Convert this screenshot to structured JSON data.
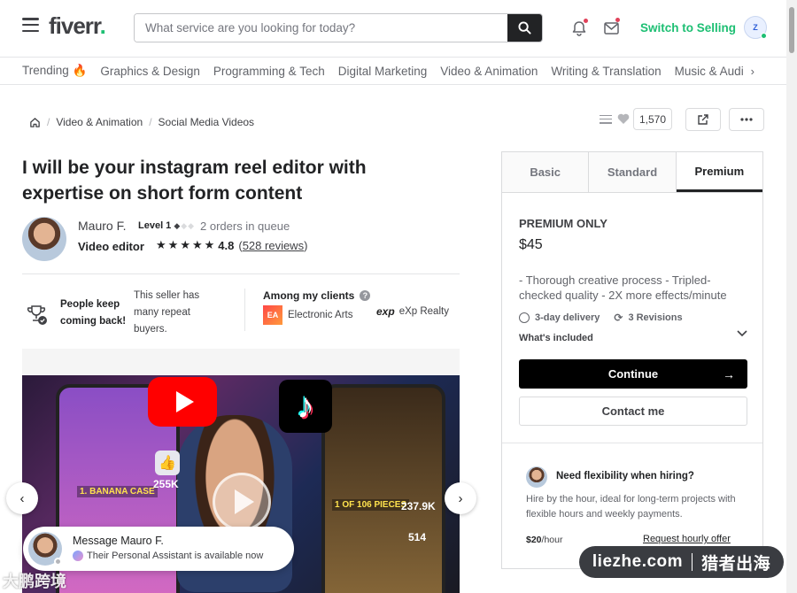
{
  "header": {
    "logo_text": "fiverr",
    "logo_dot": ".",
    "search_placeholder": "What service are you looking for today?",
    "switch_label": "Switch to Selling",
    "avatar_text": "Z"
  },
  "categories": [
    "Trending 🔥",
    "Graphics & Design",
    "Programming & Tech",
    "Digital Marketing",
    "Video & Animation",
    "Writing & Translation",
    "Music & Audi"
  ],
  "categories_more": "›",
  "breadcrumb": {
    "sep1": "/",
    "item1": "Video & Animation",
    "sep2": "/",
    "item2": "Social Media Videos"
  },
  "actions": {
    "likes_count": "1,570"
  },
  "gig": {
    "title": "I will be your instagram reel editor with expertise on short form content"
  },
  "seller": {
    "name": "Mauro F.",
    "level": "Level 1",
    "queue": "2 orders in queue",
    "role": "Video editor",
    "rating": "4.8",
    "reviews_open": "(",
    "reviews": "528 reviews",
    "reviews_close": ")"
  },
  "info": {
    "keep_back": "People keep coming back!",
    "repeat": "This seller has many repeat buyers.",
    "clients_title": "Among my clients",
    "client1_logo": "EA",
    "client1": "Electronic Arts",
    "client2_logo": "exp",
    "client2": "eXp Realty"
  },
  "gallery": {
    "label1": "1. BANANA CASE",
    "count1": "255K",
    "label2": "1 OF 106 PIECES",
    "count2": "237.9K",
    "count3": "514"
  },
  "message": {
    "title": "Message Mauro F.",
    "subtitle": "Their Personal Assistant is available now"
  },
  "package": {
    "tabs": [
      "Basic",
      "Standard",
      "Premium"
    ],
    "active_tab": 2,
    "name": "PREMIUM ONLY",
    "price": "$45",
    "description": "- Thorough creative process - Tripled-checked quality - 2X more effects/minute",
    "delivery": "3-day delivery",
    "revisions": "3 Revisions",
    "included": "What's included",
    "continue_label": "Continue",
    "contact_label": "Contact me"
  },
  "hourly": {
    "title": "Need flexibility when hiring?",
    "description": "Hire by the hour, ideal for long-term projects with flexible hours and weekly payments.",
    "rate": "$20",
    "rate_unit": "/hour",
    "link": "Request hourly offer"
  },
  "watermark": {
    "left": "大鹏跨境",
    "domain": "liezhe.com",
    "brand": "猎者出海"
  },
  "colors": {
    "brand_green": "#1dbf73",
    "dark": "#222325",
    "notification_badge": "#e0425a"
  }
}
